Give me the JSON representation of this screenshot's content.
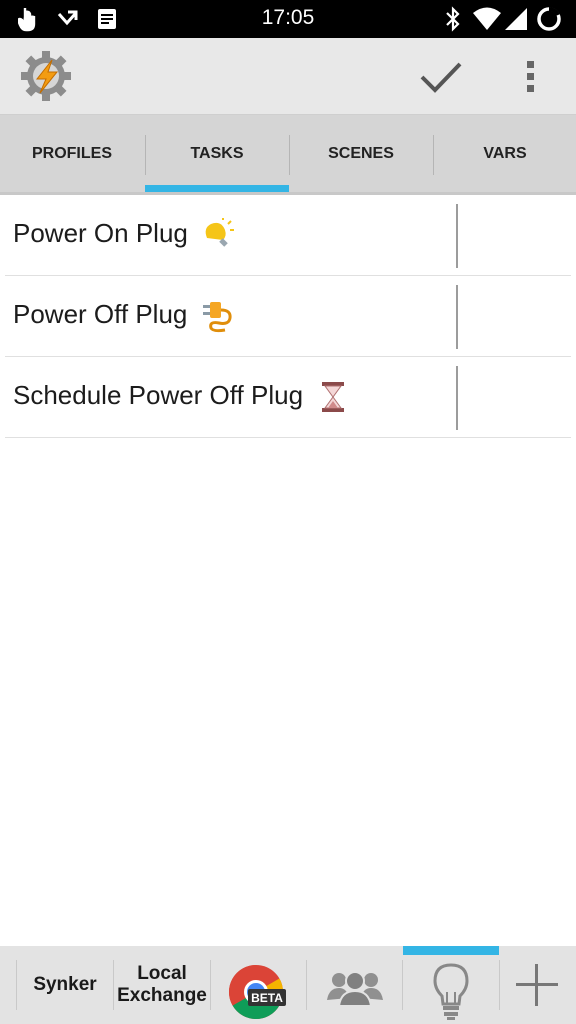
{
  "status_bar": {
    "time": "17:05",
    "left_icons": [
      "touch-icon",
      "missed-call-icon",
      "notes-icon"
    ],
    "right_icons": [
      "bluetooth-icon",
      "wifi-icon",
      "signal-icon",
      "battery-charging-icon"
    ]
  },
  "action_bar": {
    "logo_icon": "tasker-gear-bolt-icon",
    "confirm_icon": "checkmark-icon",
    "menu_icon": "overflow-menu-icon"
  },
  "tabs": [
    {
      "label": "PROFILES",
      "selected": false
    },
    {
      "label": "TASKS",
      "selected": true
    },
    {
      "label": "SCENES",
      "selected": false
    },
    {
      "label": "VARS",
      "selected": false
    }
  ],
  "tasks": [
    {
      "label": "Power On Plug",
      "icon": "light-bulb-icon"
    },
    {
      "label": "Power Off Plug",
      "icon": "plug-icon"
    },
    {
      "label": "Schedule Power Off Plug",
      "icon": "hourglass-icon"
    }
  ],
  "bottom_bar": {
    "items": [
      {
        "label": "Synker"
      },
      {
        "label_line1": "Local",
        "label_line2": "Exchange"
      },
      {
        "icon": "chrome-beta-icon",
        "badge": "BETA"
      },
      {
        "icon": "people-group-icon"
      },
      {
        "icon": "light-bulb-outline-icon",
        "selected": true
      },
      {
        "icon": "plus-icon"
      }
    ]
  },
  "colors": {
    "accent": "#33b5e5",
    "action_bar": "#e8e8e8",
    "tab_bar": "#d5d5d5",
    "status_bar": "#000000"
  }
}
